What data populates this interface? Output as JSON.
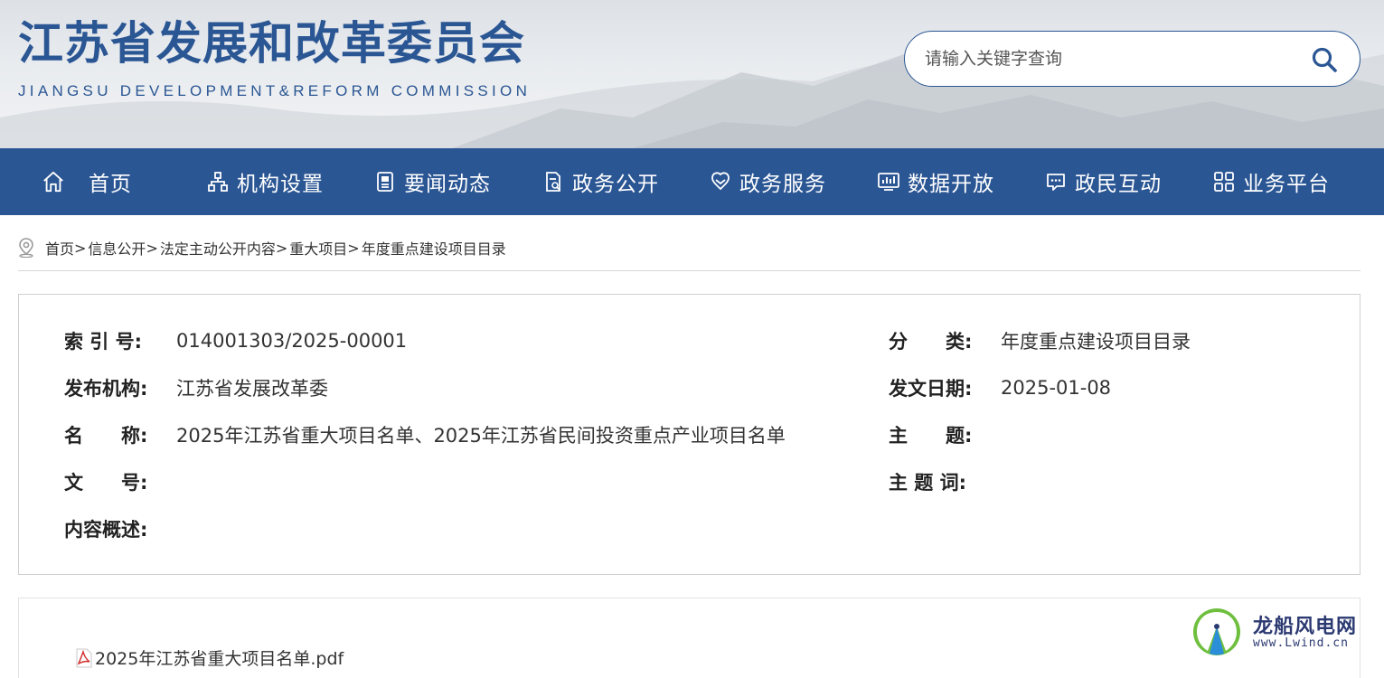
{
  "header": {
    "title": "江苏省发展和改革委员会",
    "subtitle": "JIANGSU DEVELOPMENT&REFORM COMMISSION",
    "search_placeholder": "请输入关键字查询"
  },
  "nav": {
    "items": [
      {
        "label": "首页",
        "icon": "home-icon"
      },
      {
        "label": "机构设置",
        "icon": "org-structure-icon"
      },
      {
        "label": "要闻动态",
        "icon": "news-icon"
      },
      {
        "label": "政务公开",
        "icon": "document-icon"
      },
      {
        "label": "政务服务",
        "icon": "service-hands-icon"
      },
      {
        "label": "数据开放",
        "icon": "data-chart-icon"
      },
      {
        "label": "政民互动",
        "icon": "chat-icon"
      },
      {
        "label": "业务平台",
        "icon": "grid-icon"
      }
    ]
  },
  "breadcrumb": [
    "首页",
    "信息公开",
    "法定主动公开内容",
    "重大项目",
    "年度重点建设项目目录"
  ],
  "breadcrumb_separator": ">",
  "info": {
    "left": [
      {
        "key": "索 引 号:",
        "value": "014001303/2025-00001"
      },
      {
        "key": "发布机构:",
        "value": "江苏省发展改革委"
      },
      {
        "key": "名　　称:",
        "value": "2025年江苏省重大项目名单、2025年江苏省民间投资重点产业项目名单"
      },
      {
        "key": "文　　号:",
        "value": ""
      },
      {
        "key": "内容概述:",
        "value": ""
      }
    ],
    "right": [
      {
        "key": "分　　类:",
        "value": "年度重点建设项目目录"
      },
      {
        "key": "发文日期:",
        "value": "2025-01-08"
      },
      {
        "key": "主　　题:",
        "value": ""
      },
      {
        "key": "主 题 词:",
        "value": ""
      }
    ]
  },
  "attachment": {
    "filename": "2025年江苏省重大项目名单.pdf",
    "icon": "pdf-icon"
  },
  "watermark": {
    "title": "龙船风电网",
    "url": "www.Lwind.cn"
  },
  "colors": {
    "primary": "#2b5694",
    "text": "#333333",
    "border": "#d0d0d0"
  }
}
